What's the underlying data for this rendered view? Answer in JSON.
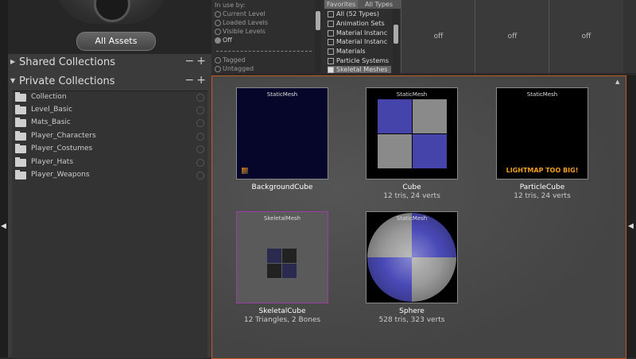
{
  "header": {
    "all_assets_label": "All Assets"
  },
  "sections": {
    "shared": {
      "label": "Shared Collections"
    },
    "private": {
      "label": "Private Collections"
    }
  },
  "collections": [
    "Collection",
    "Level_Basic",
    "Mats_Basic",
    "Player_Characters",
    "Player_Costumes",
    "Player_Hats",
    "Player_Weapons"
  ],
  "filters": {
    "in_use": {
      "title": "In use by:",
      "options": [
        "Current Level",
        "Loaded Levels",
        "Visible Levels",
        "Off"
      ],
      "tagged": [
        "Tagged",
        "Untagged"
      ]
    },
    "types": {
      "tabs": [
        "Favorites",
        "All Types"
      ],
      "items": [
        "All (52 Types)",
        "Animation Sets",
        "Material Instanc",
        "Material Instanc",
        "Materials",
        "Particle Systems",
        "Skeletal Meshes"
      ]
    },
    "off_columns": [
      "off",
      "off",
      "off"
    ]
  },
  "assets": [
    {
      "type": "StaticMesh",
      "name": "BackgroundCube",
      "info": ""
    },
    {
      "type": "StaticMesh",
      "name": "Cube",
      "info": "12 tris, 24 verts"
    },
    {
      "type": "StaticMesh",
      "name": "ParticleCube",
      "info": "12 tris, 24 verts",
      "warning": "LIGHTMAP TOO BIG!"
    },
    {
      "type": "SkeletalMesh",
      "name": "SkeletalCube",
      "info": "12 Triangles, 2 Bones"
    },
    {
      "type": "StaticMesh",
      "name": "Sphere",
      "info": "528 tris, 323 verts"
    }
  ]
}
